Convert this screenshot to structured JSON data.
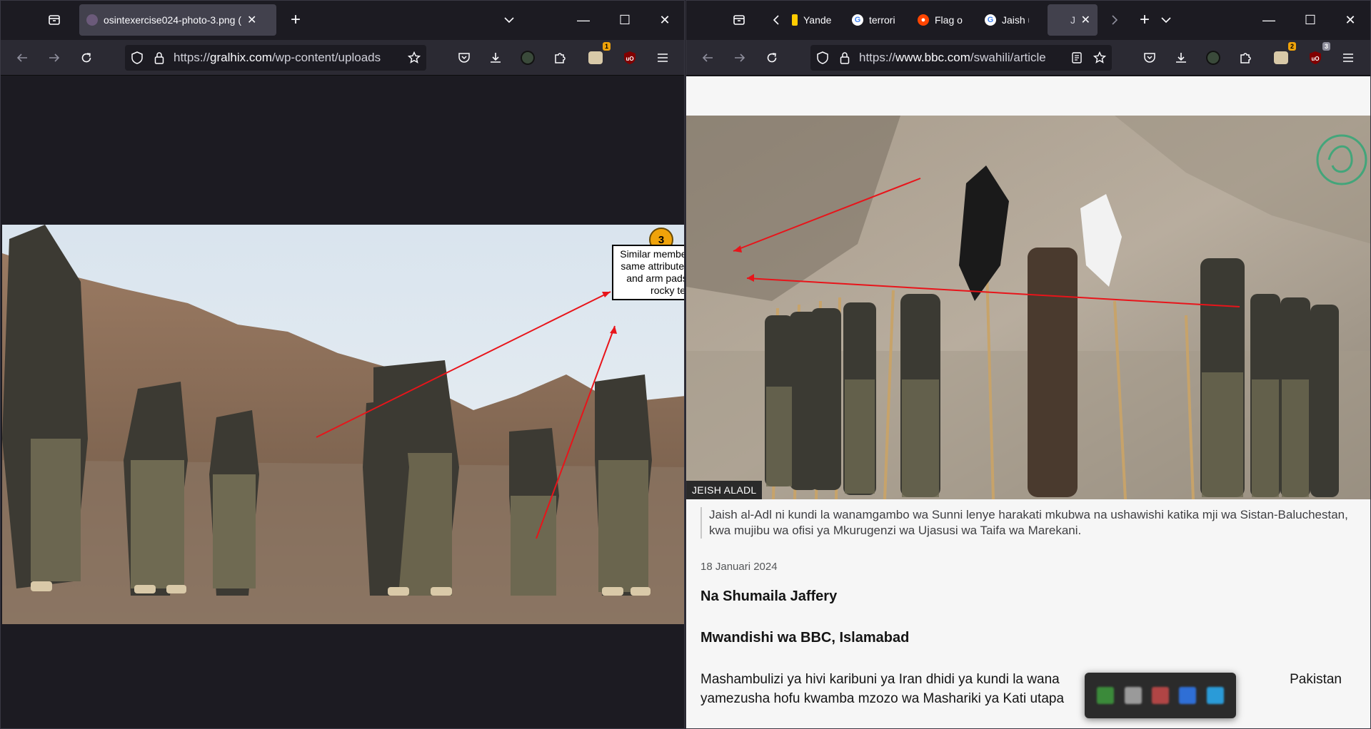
{
  "left_window": {
    "tab": {
      "title": "osintexercise024-photo-3.png (",
      "close": "✕"
    },
    "new_tab": "+",
    "url": {
      "scheme": "https://",
      "host": "gralhix.com",
      "path": "/wp-content/uploads"
    },
    "window_controls": {
      "minimize": "—",
      "maximize": "☐",
      "close": "✕"
    },
    "extension_badge": "1",
    "annotation": {
      "number": "3",
      "text": "Similar members having the same attributes that is knee and arm pads, mask with rocky terrains."
    }
  },
  "right_window": {
    "tabs": [
      {
        "title": "Yande",
        "icon": "yandex-icon",
        "color": "#ffcc00"
      },
      {
        "title": "terrori",
        "icon": "google-icon",
        "color": "#4285f4"
      },
      {
        "title": "Flag o",
        "icon": "reddit-icon",
        "color": "#ff4500"
      },
      {
        "title": "Jaish u",
        "icon": "google-icon",
        "color": "#4285f4"
      },
      {
        "title": "Jais",
        "icon": "bbc-icon",
        "color": "#000000",
        "active": true
      }
    ],
    "url": {
      "scheme": "https://",
      "host": "www.bbc.com",
      "path": "/swahili/article"
    },
    "extension_badges": {
      "first": "2",
      "second": "3"
    },
    "image_credit": "JEISH ALADL",
    "caption": "Jaish al-Adl ni kundi la wanamgambo wa Sunni lenye harakati mkubwa na ushawishi katika mji wa Sistan-Baluchestan, kwa mujibu wa ofisi ya Mkurugenzi wa Ujasusi wa Taifa wa Marekani.",
    "date": "18 Januari 2024",
    "author": "Na Shumaila Jaffery",
    "author_role": "Mwandishi wa BBC, Islamabad",
    "body_line1_start": "Mashambulizi ya hivi karibuni ya Iran dhidi ya kundi la wana",
    "body_line1_end": "Pakistan",
    "body_line2": "yamezusha hofu kwamba mzozo wa Mashariki ya Kati utapa"
  },
  "colors": {
    "chrome_bg": "#1c1b22",
    "toolbar_bg": "#2b2a33",
    "active_tab": "#42414d",
    "annotation_arrow": "#e8141a",
    "badge_orange": "#f0a30a"
  }
}
